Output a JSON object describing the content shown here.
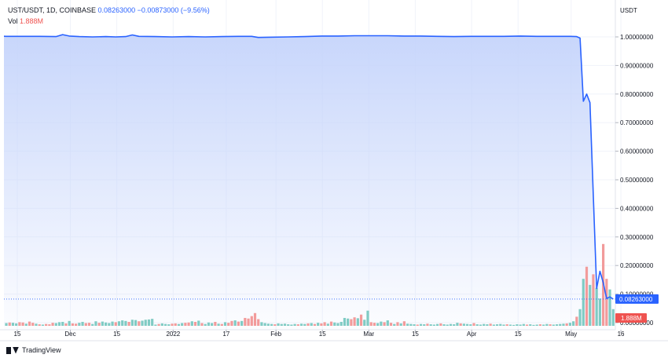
{
  "legend": {
    "symbol": "UST/USDT, 1D, COINBASE",
    "price": "0.08263000",
    "change": "−0.00873000 (−9.56%)",
    "vol_label": "Vol",
    "vol_value": "1.888M"
  },
  "brand": {
    "name": "TradingView"
  },
  "colors": {
    "line": "#2962ff",
    "area_top": "#c5d4fb",
    "vol_up": "#80cbc4",
    "vol_down": "#f29b9b",
    "price_tag": "#2962ff",
    "vol_tag": "#ef5350"
  },
  "chart_data": {
    "type": "area",
    "yaxis_title": "USDT",
    "ylim": [
      0,
      1.1
    ],
    "yticks": [
      "1.00000000",
      "0.90000000",
      "0.80000000",
      "0.70000000",
      "0.60000000",
      "0.50000000",
      "0.40000000",
      "0.30000000",
      "0.20000000",
      "0.10000000",
      "0.00000000"
    ],
    "ytick_values": [
      1.0,
      0.9,
      0.8,
      0.7,
      0.6,
      0.5,
      0.4,
      0.3,
      0.2,
      0.1,
      0.0
    ],
    "last_price": 0.08263,
    "last_price_label": "0.08263000",
    "last_volume_label": "1.888M",
    "xticks": [
      {
        "label": "15",
        "day": 0
      },
      {
        "label": "Dec",
        "day": 16
      },
      {
        "label": "15",
        "day": 30
      },
      {
        "label": "2022",
        "day": 47
      },
      {
        "label": "17",
        "day": 63
      },
      {
        "label": "Feb",
        "day": 78
      },
      {
        "label": "15",
        "day": 92
      },
      {
        "label": "Mar",
        "day": 106
      },
      {
        "label": "15",
        "day": 120
      },
      {
        "label": "Apr",
        "day": 137
      },
      {
        "label": "15",
        "day": 151
      },
      {
        "label": "May",
        "day": 167
      },
      {
        "label": "16",
        "day": 182
      }
    ],
    "series": [
      {
        "label": "UST/USDT",
        "points": [
          [
            -2,
            1.003
          ],
          [
            0,
            1.002
          ],
          [
            5,
            1.002
          ],
          [
            10,
            1.002
          ],
          [
            15,
            1.001
          ],
          [
            17,
            1.008
          ],
          [
            19,
            1.003
          ],
          [
            22,
            1.001
          ],
          [
            26,
            1.0
          ],
          [
            30,
            1.001
          ],
          [
            33,
            1.0
          ],
          [
            36,
            1.001
          ],
          [
            38,
            1.007
          ],
          [
            40,
            1.002
          ],
          [
            45,
            1.001
          ],
          [
            50,
            1.0
          ],
          [
            55,
            1.001
          ],
          [
            60,
            1.0
          ],
          [
            65,
            1.001
          ],
          [
            70,
            1.002
          ],
          [
            74,
            1.002
          ],
          [
            76,
            0.998
          ],
          [
            79,
            0.999
          ],
          [
            85,
            1.0
          ],
          [
            90,
            1.001
          ],
          [
            95,
            1.003
          ],
          [
            100,
            1.003
          ],
          [
            105,
            1.004
          ],
          [
            110,
            1.004
          ],
          [
            115,
            1.004
          ],
          [
            120,
            1.003
          ],
          [
            125,
            1.003
          ],
          [
            130,
            1.002
          ],
          [
            135,
            1.001
          ],
          [
            140,
            1.002
          ],
          [
            145,
            1.002
          ],
          [
            150,
            1.002
          ],
          [
            155,
            1.003
          ],
          [
            160,
            1.002
          ],
          [
            165,
            1.002
          ],
          [
            170,
            1.002
          ],
          [
            172,
            1.001
          ],
          [
            173,
            0.996
          ],
          [
            174,
            0.775
          ],
          [
            175,
            0.8
          ],
          [
            176,
            0.77
          ],
          [
            178,
            0.12
          ],
          [
            179,
            0.18
          ],
          [
            180,
            0.14
          ],
          [
            181,
            0.085
          ],
          [
            182,
            0.09
          ],
          [
            183,
            0.0826
          ]
        ]
      }
    ],
    "volume_max": 2.85,
    "volume_unit": "M",
    "volume": [
      [
        0,
        0.09,
        "up"
      ],
      [
        1,
        0.11,
        "down"
      ],
      [
        2,
        0.1,
        "up"
      ],
      [
        3,
        0.08,
        "up"
      ],
      [
        4,
        0.12,
        "down"
      ],
      [
        5,
        0.11,
        "down"
      ],
      [
        6,
        0.07,
        "up"
      ],
      [
        7,
        0.14,
        "down"
      ],
      [
        8,
        0.1,
        "down"
      ],
      [
        9,
        0.07,
        "up"
      ],
      [
        10,
        0.05,
        "down"
      ],
      [
        11,
        0.04,
        "up"
      ],
      [
        12,
        0.06,
        "down"
      ],
      [
        13,
        0.05,
        "down"
      ],
      [
        14,
        0.1,
        "down"
      ],
      [
        15,
        0.09,
        "up"
      ],
      [
        16,
        0.12,
        "up"
      ],
      [
        17,
        0.13,
        "up"
      ],
      [
        18,
        0.08,
        "down"
      ],
      [
        19,
        0.16,
        "up"
      ],
      [
        20,
        0.08,
        "down"
      ],
      [
        21,
        0.07,
        "down"
      ],
      [
        22,
        0.1,
        "up"
      ],
      [
        23,
        0.13,
        "up"
      ],
      [
        24,
        0.09,
        "down"
      ],
      [
        25,
        0.1,
        "down"
      ],
      [
        26,
        0.06,
        "up"
      ],
      [
        27,
        0.15,
        "up"
      ],
      [
        28,
        0.1,
        "down"
      ],
      [
        29,
        0.14,
        "up"
      ],
      [
        30,
        0.11,
        "up"
      ],
      [
        31,
        0.09,
        "up"
      ],
      [
        32,
        0.14,
        "up"
      ],
      [
        33,
        0.12,
        "down"
      ],
      [
        34,
        0.15,
        "up"
      ],
      [
        35,
        0.18,
        "up"
      ],
      [
        36,
        0.16,
        "up"
      ],
      [
        37,
        0.13,
        "down"
      ],
      [
        38,
        0.2,
        "up"
      ],
      [
        39,
        0.19,
        "up"
      ],
      [
        40,
        0.15,
        "down"
      ],
      [
        41,
        0.17,
        "up"
      ],
      [
        42,
        0.2,
        "up"
      ],
      [
        43,
        0.21,
        "up"
      ],
      [
        44,
        0.23,
        "up"
      ],
      [
        45,
        0.04,
        "up"
      ],
      [
        46,
        0.06,
        "down"
      ],
      [
        47,
        0.08,
        "up"
      ],
      [
        48,
        0.06,
        "up"
      ],
      [
        49,
        0.05,
        "up"
      ],
      [
        50,
        0.07,
        "down"
      ],
      [
        51,
        0.08,
        "down"
      ],
      [
        52,
        0.06,
        "up"
      ],
      [
        53,
        0.09,
        "up"
      ],
      [
        54,
        0.1,
        "down"
      ],
      [
        55,
        0.11,
        "down"
      ],
      [
        56,
        0.15,
        "up"
      ],
      [
        57,
        0.13,
        "down"
      ],
      [
        58,
        0.17,
        "up"
      ],
      [
        59,
        0.09,
        "down"
      ],
      [
        60,
        0.06,
        "up"
      ],
      [
        61,
        0.11,
        "up"
      ],
      [
        62,
        0.09,
        "up"
      ],
      [
        63,
        0.13,
        "down"
      ],
      [
        64,
        0.07,
        "up"
      ],
      [
        65,
        0.06,
        "down"
      ],
      [
        66,
        0.12,
        "up"
      ],
      [
        67,
        0.1,
        "down"
      ],
      [
        68,
        0.16,
        "down"
      ],
      [
        69,
        0.18,
        "up"
      ],
      [
        70,
        0.14,
        "down"
      ],
      [
        71,
        0.16,
        "up"
      ],
      [
        72,
        0.26,
        "down"
      ],
      [
        73,
        0.24,
        "down"
      ],
      [
        74,
        0.32,
        "down"
      ],
      [
        75,
        0.42,
        "down"
      ],
      [
        76,
        0.22,
        "down"
      ],
      [
        77,
        0.12,
        "up"
      ],
      [
        78,
        0.09,
        "up"
      ],
      [
        79,
        0.07,
        "up"
      ],
      [
        80,
        0.06,
        "up"
      ],
      [
        81,
        0.05,
        "down"
      ],
      [
        82,
        0.08,
        "up"
      ],
      [
        83,
        0.06,
        "up"
      ],
      [
        84,
        0.07,
        "up"
      ],
      [
        85,
        0.05,
        "up"
      ],
      [
        86,
        0.04,
        "up"
      ],
      [
        87,
        0.06,
        "up"
      ],
      [
        88,
        0.05,
        "down"
      ],
      [
        89,
        0.07,
        "up"
      ],
      [
        90,
        0.06,
        "up"
      ],
      [
        91,
        0.08,
        "down"
      ],
      [
        92,
        0.09,
        "up"
      ],
      [
        93,
        0.06,
        "down"
      ],
      [
        94,
        0.1,
        "up"
      ],
      [
        95,
        0.08,
        "down"
      ],
      [
        96,
        0.12,
        "down"
      ],
      [
        97,
        0.07,
        "up"
      ],
      [
        98,
        0.14,
        "down"
      ],
      [
        99,
        0.11,
        "up"
      ],
      [
        100,
        0.09,
        "up"
      ],
      [
        101,
        0.13,
        "up"
      ],
      [
        102,
        0.26,
        "up"
      ],
      [
        103,
        0.24,
        "up"
      ],
      [
        104,
        0.22,
        "down"
      ],
      [
        105,
        0.28,
        "down"
      ],
      [
        106,
        0.25,
        "up"
      ],
      [
        107,
        0.37,
        "down"
      ],
      [
        108,
        0.2,
        "up"
      ],
      [
        109,
        0.5,
        "up"
      ],
      [
        110,
        0.12,
        "down"
      ],
      [
        111,
        0.1,
        "down"
      ],
      [
        112,
        0.09,
        "up"
      ],
      [
        113,
        0.14,
        "up"
      ],
      [
        114,
        0.12,
        "down"
      ],
      [
        115,
        0.18,
        "up"
      ],
      [
        116,
        0.1,
        "down"
      ],
      [
        117,
        0.06,
        "up"
      ],
      [
        118,
        0.12,
        "down"
      ],
      [
        119,
        0.08,
        "up"
      ],
      [
        120,
        0.15,
        "down"
      ],
      [
        121,
        0.07,
        "up"
      ],
      [
        122,
        0.06,
        "up"
      ],
      [
        123,
        0.05,
        "up"
      ],
      [
        124,
        0.04,
        "down"
      ],
      [
        125,
        0.06,
        "up"
      ],
      [
        126,
        0.05,
        "up"
      ],
      [
        127,
        0.07,
        "down"
      ],
      [
        128,
        0.05,
        "up"
      ],
      [
        129,
        0.04,
        "up"
      ],
      [
        130,
        0.06,
        "up"
      ],
      [
        131,
        0.08,
        "down"
      ],
      [
        132,
        0.05,
        "up"
      ],
      [
        133,
        0.04,
        "up"
      ],
      [
        134,
        0.06,
        "up"
      ],
      [
        135,
        0.05,
        "up"
      ],
      [
        136,
        0.1,
        "up"
      ],
      [
        137,
        0.08,
        "down"
      ],
      [
        138,
        0.07,
        "up"
      ],
      [
        139,
        0.06,
        "up"
      ],
      [
        140,
        0.05,
        "up"
      ],
      [
        141,
        0.09,
        "down"
      ],
      [
        142,
        0.05,
        "up"
      ],
      [
        143,
        0.04,
        "up"
      ],
      [
        144,
        0.06,
        "up"
      ],
      [
        145,
        0.05,
        "up"
      ],
      [
        146,
        0.07,
        "down"
      ],
      [
        147,
        0.04,
        "up"
      ],
      [
        148,
        0.05,
        "up"
      ],
      [
        149,
        0.06,
        "up"
      ],
      [
        150,
        0.04,
        "up"
      ],
      [
        151,
        0.05,
        "down"
      ],
      [
        152,
        0.04,
        "up"
      ],
      [
        153,
        0.03,
        "up"
      ],
      [
        154,
        0.05,
        "up"
      ],
      [
        155,
        0.04,
        "up"
      ],
      [
        156,
        0.06,
        "up"
      ],
      [
        157,
        0.04,
        "down"
      ],
      [
        158,
        0.05,
        "up"
      ],
      [
        159,
        0.03,
        "up"
      ],
      [
        160,
        0.04,
        "up"
      ],
      [
        161,
        0.05,
        "down"
      ],
      [
        162,
        0.04,
        "up"
      ],
      [
        163,
        0.06,
        "up"
      ],
      [
        164,
        0.05,
        "down"
      ],
      [
        165,
        0.04,
        "up"
      ],
      [
        166,
        0.05,
        "up"
      ],
      [
        167,
        0.06,
        "up"
      ],
      [
        168,
        0.07,
        "up"
      ],
      [
        169,
        0.08,
        "down"
      ],
      [
        170,
        0.1,
        "up"
      ],
      [
        171,
        0.15,
        "up"
      ],
      [
        172,
        0.3,
        "down"
      ],
      [
        173,
        0.55,
        "up"
      ],
      [
        174,
        1.55,
        "up"
      ],
      [
        175,
        1.95,
        "down"
      ],
      [
        176,
        1.35,
        "up"
      ],
      [
        177,
        1.7,
        "down"
      ],
      [
        178,
        1.25,
        "up"
      ],
      [
        179,
        0.9,
        "up"
      ],
      [
        180,
        2.7,
        "down"
      ],
      [
        181,
        1.55,
        "down"
      ],
      [
        182,
        1.2,
        "up"
      ],
      [
        183,
        0.55,
        "up"
      ]
    ]
  }
}
